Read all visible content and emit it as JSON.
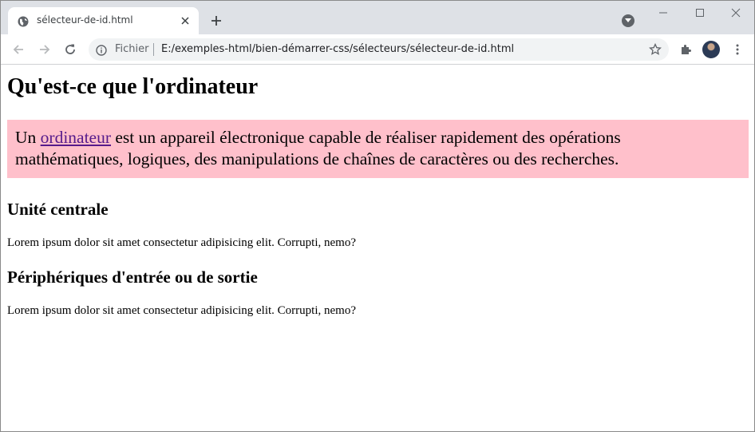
{
  "browser": {
    "tab": {
      "title": "sélecteur-de-id.html"
    },
    "omnibox": {
      "scheme_label": "Fichier",
      "url": "E:/exemples-html/bien-démarrer-css/sélecteurs/sélecteur-de-id.html"
    },
    "icons": [
      "globe-icon",
      "close-icon",
      "plus-icon",
      "chevron-down-icon",
      "minimize-icon",
      "maximize-icon",
      "close-window-icon",
      "back-arrow-icon",
      "forward-arrow-icon",
      "reload-icon",
      "info-icon",
      "star-icon",
      "puzzle-icon",
      "avatar",
      "more-vert-icon"
    ]
  },
  "page": {
    "title": "Qu'est-ce que l'ordinateur",
    "intro": {
      "prefix": "Un ",
      "link": "ordinateur",
      "line1_rest": " est un appareil électronique capable de réaliser rapidement des opérations",
      "line2": "mathématiques, logiques, des manipulations de chaînes de caractères ou des recherches.",
      "background": "#ffc0cb",
      "link_color": "#551a8b"
    },
    "sections": [
      {
        "heading": "Unité centrale",
        "text": "Lorem ipsum dolor sit amet consectetur adipisicing elit. Corrupti, nemo?"
      },
      {
        "heading": "Périphériques d'entrée ou de sortie",
        "text": "Lorem ipsum dolor sit amet consectetur adipisicing elit. Corrupti, nemo?"
      }
    ]
  }
}
